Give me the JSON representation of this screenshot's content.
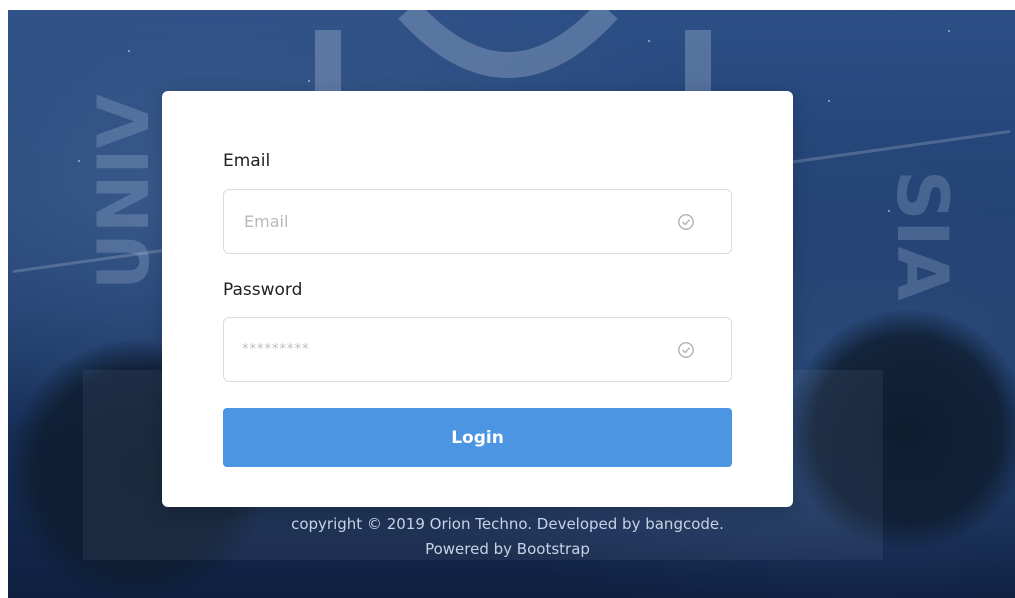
{
  "form": {
    "email_label": "Email",
    "email_placeholder": "Email",
    "password_label": "Password",
    "password_value": "*********",
    "login_label": "Login"
  },
  "footer": {
    "copyright_text": "copyright © 2019 Orion Techno. Developed by bangcode.",
    "powered_text": "Powered by Bootstrap"
  },
  "icons": {
    "email_check": "check-circle-icon",
    "password_check": "check-circle-icon"
  },
  "colors": {
    "accent": "#4b95e2",
    "background": "#1f3d6e"
  }
}
